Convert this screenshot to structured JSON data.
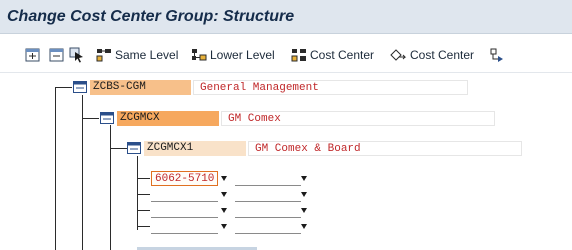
{
  "window": {
    "title": "Change Cost Center Group: Structure"
  },
  "toolbar": {
    "same_level_label": "Same Level",
    "lower_level_label": "Lower Level",
    "cost_center_label": "Cost Center",
    "cost_center_2_label": "Cost Center"
  },
  "tree": {
    "root": {
      "code": "ZCBS-CGM",
      "description": "General Management"
    },
    "child": {
      "code": "ZCGMCX",
      "description": "GM Comex"
    },
    "grandchild": {
      "code": "ZCGMCX1",
      "description": "GM Comex & Board"
    },
    "entry_rows": [
      {
        "cost_center": "6062-5710",
        "range_to": ""
      },
      {
        "cost_center": "",
        "range_to": ""
      },
      {
        "cost_center": "",
        "range_to": ""
      },
      {
        "cost_center": "",
        "range_to": ""
      }
    ]
  },
  "colors": {
    "root_code_bg": "#f7c08a",
    "child_code_bg": "#f6a85e",
    "grandchild_code_bg": "#f9e2c9",
    "description_text": "#c0282a",
    "title_bar_bg": "#dfe6ee"
  }
}
